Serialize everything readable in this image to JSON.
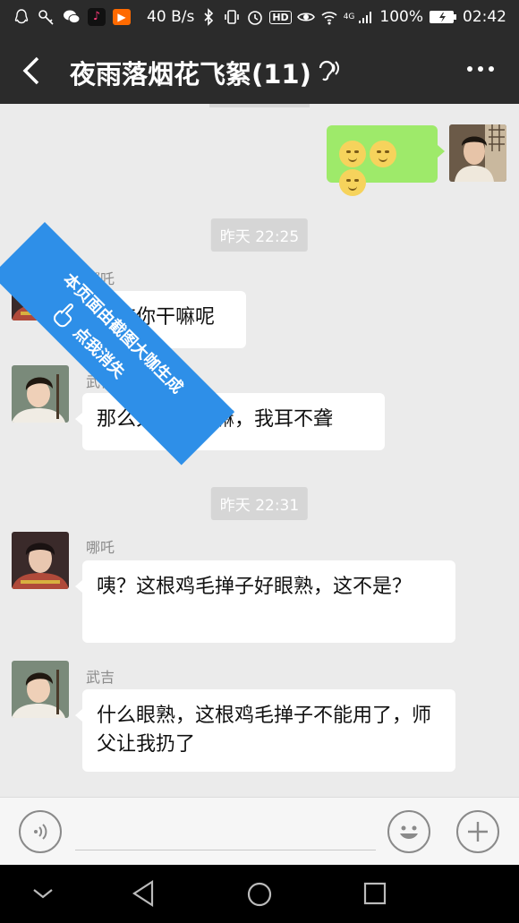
{
  "status_bar": {
    "net_speed": "40 B/s",
    "signal_badge": "4G",
    "battery": "100%",
    "time": "02:42",
    "hd_badge": "HD"
  },
  "header": {
    "title": "夜雨落烟花飞絮(11)"
  },
  "watermark": {
    "line1": "本页面由截图大咖生成",
    "line2": "点我消失"
  },
  "timestamps": [
    "昨天 22:25",
    "昨天 22:31"
  ],
  "messages": [
    {
      "sender": "",
      "text": "",
      "type": "sent-emoji",
      "emoji_count": 3
    },
    {
      "sender": "哪吒",
      "text": "武吉你干嘛呢"
    },
    {
      "sender": "武吉",
      "text": "那么大嗓门干嘛，我耳不聋"
    },
    {
      "sender": "哪吒",
      "text": "咦？这根鸡毛掸子好眼熟，这不是？"
    },
    {
      "sender": "武吉",
      "text": "什么眼熟，这根鸡毛掸子不能用了，师父让我扔了"
    }
  ],
  "colors": {
    "header_bg": "#2b2b2b",
    "chat_bg": "#ebebeb",
    "sent_bubble": "#9eea6a",
    "ribbon": "#2e8fe8"
  }
}
